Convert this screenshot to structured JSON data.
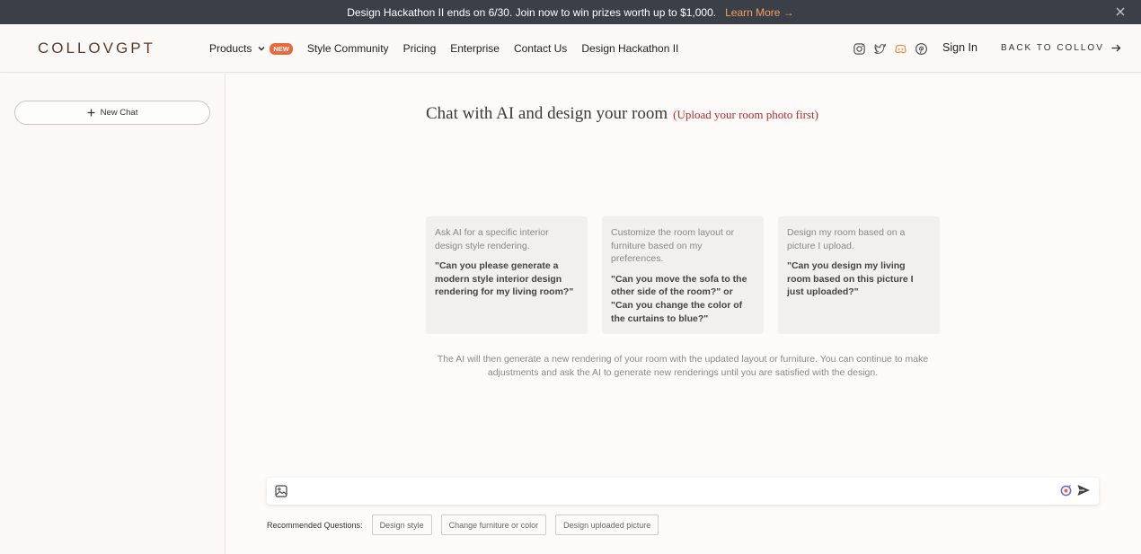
{
  "banner": {
    "message": "Design Hackathon II ends on 6/30. Join now to win prizes worth up to $1,000.",
    "learn_more": "Learn More →"
  },
  "header": {
    "logo": "COLLOVGPT",
    "nav": [
      {
        "label": "Products",
        "badge": "NEW"
      },
      {
        "label": "Style Community"
      },
      {
        "label": "Pricing"
      },
      {
        "label": "Enterprise"
      },
      {
        "label": "Contact Us"
      },
      {
        "label": "Design Hackathon II"
      }
    ],
    "social_icons": [
      "instagram-icon",
      "twitter-icon",
      "discord-icon",
      "pinterest-icon"
    ],
    "sign_in": "Sign In",
    "back_to": "BACK TO COLLOV"
  },
  "sidebar": {
    "new_chat": "New Chat"
  },
  "main": {
    "title": "Chat with AI and design your room",
    "subtitle": "(Upload your room photo first)",
    "cards": [
      {
        "desc": "Ask AI for a specific interior design style rendering.",
        "quote": "\"Can you please generate a modern style interior design rendering for my living room?\""
      },
      {
        "desc": "Customize the room layout or furniture based on my preferences.",
        "quote": "\"Can you move the sofa to the other side of the room?\" or \"Can you change the color of the curtains to blue?\""
      },
      {
        "desc": "Design my room based on a picture I upload.",
        "quote": "\"Can you design my living room based on this picture I just uploaded?\""
      }
    ],
    "info": "The AI will then generate a new rendering of your room with the updated layout or furniture. You can continue to make adjustments and ask the AI to generate new renderings until you are satisfied with the design."
  },
  "input": {
    "value": "",
    "placeholder": ""
  },
  "recommended": {
    "label": "Recommended Questions:",
    "chips": [
      "Design style",
      "Change furniture or color",
      "Design uploaded picture"
    ]
  },
  "colors": {
    "banner_bg": "#3b3f48",
    "accent": "#e86a3c",
    "subtitle": "#b42a2a"
  }
}
